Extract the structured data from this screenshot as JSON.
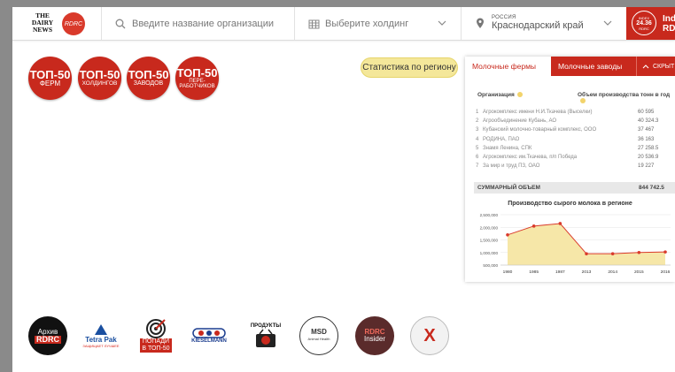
{
  "header": {
    "logo_text": "THE DAIRY NEWS",
    "logo_mark": "RDRC",
    "search_placeholder": "Введите название организации",
    "holding_placeholder": "Выберите холдинг",
    "region_country": "РОССИЯ",
    "region_value": "Краснодарский край",
    "insider_badge_top": "INDEX",
    "insider_badge_value": "24.36",
    "insider_badge_bottom": "RDRC",
    "insider_text_line1": "Ind",
    "insider_text_line2": "RDI"
  },
  "top50": [
    {
      "big": "ТОП-50",
      "small": "ФЕРМ"
    },
    {
      "big": "ТОП-50",
      "small": "ХОЛДИНГОВ"
    },
    {
      "big": "ТОП-50",
      "small": "ЗАВОДОВ"
    },
    {
      "big": "ТОП-50",
      "small": "ПЕРЕ-\nРАБОТЧИКОВ"
    }
  ],
  "stats_button": "Статистика по региону",
  "panel": {
    "tab_farms": "Молочные фермы",
    "tab_plants": "Молочные заводы",
    "tab_hide": "СКРЫТ",
    "col_org": "Организация",
    "col_volume": "Объем производства тонн в год",
    "rows": [
      {
        "n": "1",
        "name": "Агрокомплекс имени Н.И.Ткачева (Выселки)",
        "value": "60 595"
      },
      {
        "n": "2",
        "name": "Агрообъединение Кубань, АО",
        "value": "40 324.3"
      },
      {
        "n": "3",
        "name": "Кубанский молочно-товарный комплекс, ООО",
        "value": "37 467"
      },
      {
        "n": "4",
        "name": "РОДИНА, ПАО",
        "value": "36 163"
      },
      {
        "n": "5",
        "name": "Знамя Ленина, СПК",
        "value": "27 258.5"
      },
      {
        "n": "6",
        "name": "Агрокомплекс им.Ткачева, п/п Победа",
        "value": "20 536.9"
      },
      {
        "n": "7",
        "name": "За мир и труд ПЗ, ОАО",
        "value": "19 227"
      }
    ],
    "sum_label": "СУММАРНЫЙ ОБЪЕМ",
    "sum_value": "844 742.5",
    "chart_title": "Производство сырого молока в регионе"
  },
  "chart_data": {
    "type": "area",
    "title": "Производство сырого молока в регионе",
    "x": [
      "1980",
      "1985",
      "1987",
      "2013",
      "2014",
      "2015",
      "2016"
    ],
    "y_ticks": [
      "2,500,000",
      "2,000,000",
      "1,500,000",
      "1,000,000",
      "500,000"
    ],
    "values": [
      1700000,
      2050000,
      2150000,
      950000,
      950000,
      1000000,
      1020000
    ],
    "ylim": [
      500000,
      2500000
    ],
    "grid": true,
    "colors": {
      "line": "#d93a2b",
      "fill": "#f6e7a8"
    }
  },
  "logos": [
    {
      "name": "archive-rdrc-logo",
      "line1": "Архив",
      "line2": "RDRC"
    },
    {
      "name": "tetra-pak-logo",
      "line1": "Tetra Pak",
      "line2": "ЗАЩИЩАЕТ ЛУЧШЕЕ"
    },
    {
      "name": "popadi-top50-logo",
      "line1": "ПОПАДИ",
      "line2": "В ТОП-50"
    },
    {
      "name": "kieselmann-logo",
      "line1": "KIESELMANN"
    },
    {
      "name": "produkty-logo",
      "line1": "ПРОДУКТЫ"
    },
    {
      "name": "msd-logo",
      "line1": "MSD",
      "line2": "Animal Health"
    },
    {
      "name": "rdrc-insider-logo",
      "line1": "RDRC",
      "line2": "Insider"
    },
    {
      "name": "ball-logo",
      "line1": "X"
    }
  ],
  "colors": {
    "brand_red": "#c8291d",
    "button_yellow": "#f4e79a"
  }
}
